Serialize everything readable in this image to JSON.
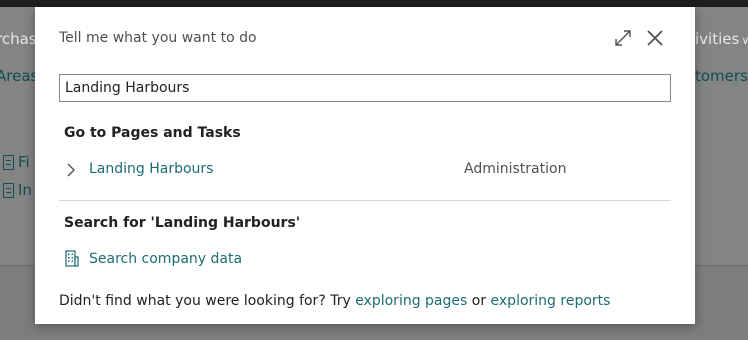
{
  "background": {
    "nav_left_1": "rchase",
    "nav_left_2": "Areas",
    "nav_right_1": "ivities",
    "nav_right_2": "tomers",
    "list_1": "Fi",
    "list_2": "In"
  },
  "dialog": {
    "title": "Tell me what you want to do",
    "search": {
      "value": "Landing Harbours"
    },
    "pages_section": {
      "heading": "Go to Pages and Tasks",
      "results": [
        {
          "label": "Landing Harbours",
          "category": "Administration"
        }
      ]
    },
    "search_section": {
      "heading": "Search for 'Landing Harbours'",
      "link": "Search company data"
    },
    "footer": {
      "prefix": "Didn't find what you were looking for? Try ",
      "link1": "exploring pages",
      "middle": " or ",
      "link2": "exploring reports"
    }
  },
  "colors": {
    "link": "#1c6c76",
    "overlay": "#848484",
    "dialog_bg": "#ffffff"
  },
  "icons": [
    "expand-icon",
    "close-icon",
    "chevron-right-icon",
    "building-icon",
    "document-icon",
    "chevron-down-icon"
  ]
}
